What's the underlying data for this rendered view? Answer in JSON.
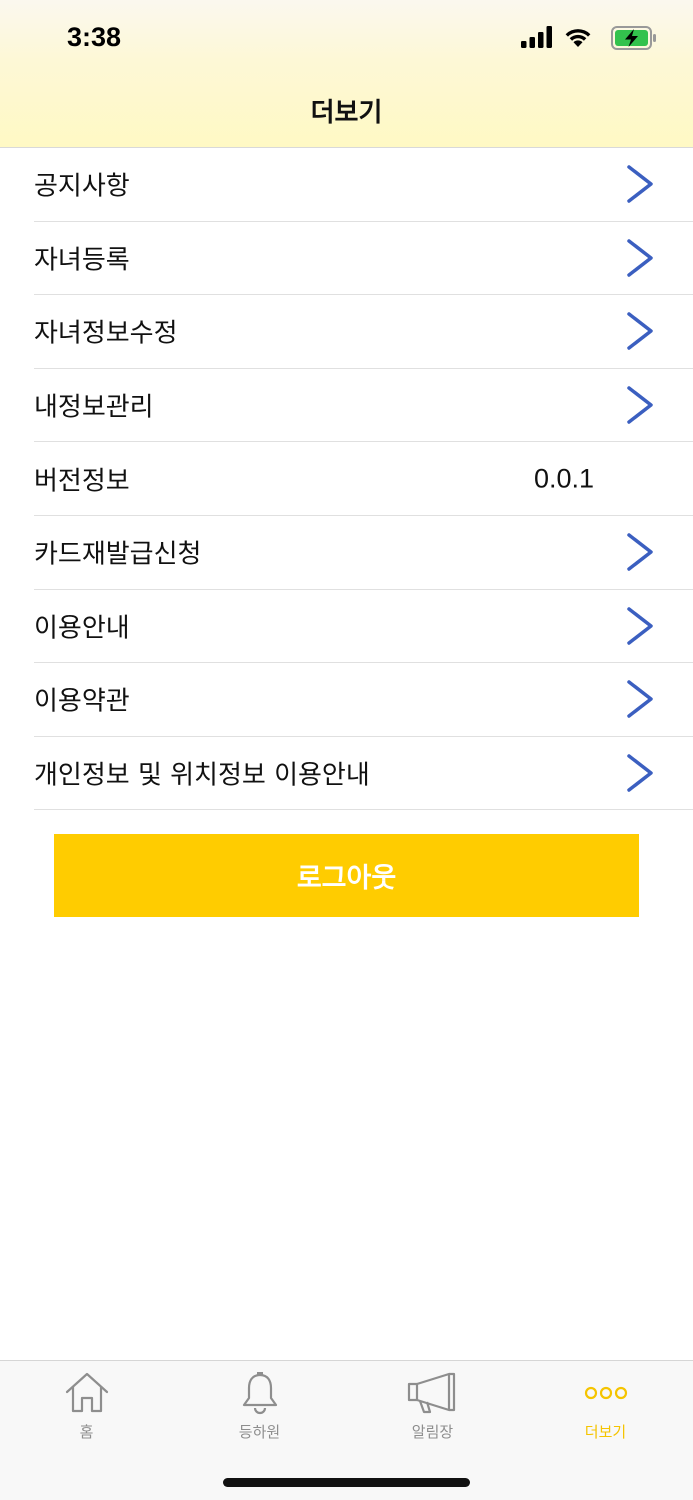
{
  "status_bar": {
    "time": "3:38"
  },
  "header": {
    "title": "더보기"
  },
  "menu": [
    {
      "label": "공지사항",
      "has_chevron": true
    },
    {
      "label": "자녀등록",
      "has_chevron": true
    },
    {
      "label": "자녀정보수정",
      "has_chevron": true
    },
    {
      "label": "내정보관리",
      "has_chevron": true
    },
    {
      "label": "버전정보",
      "value": "0.0.1",
      "has_chevron": false
    },
    {
      "label": "카드재발급신청",
      "has_chevron": true
    },
    {
      "label": "이용안내",
      "has_chevron": true
    },
    {
      "label": "이용약관",
      "has_chevron": true
    },
    {
      "label": "개인정보 및 위치정보 이용안내",
      "has_chevron": true
    }
  ],
  "logout_label": "로그아웃",
  "tabs": [
    {
      "label": "홈",
      "icon": "home-icon",
      "active": false
    },
    {
      "label": "등하원",
      "icon": "bell-icon",
      "active": false
    },
    {
      "label": "알림장",
      "icon": "megaphone-icon",
      "active": false
    },
    {
      "label": "더보기",
      "icon": "more-icon",
      "active": true
    }
  ],
  "colors": {
    "accent": "#ffcc00",
    "chevron": "#3b5fc0",
    "tab_active": "#f5c400",
    "tab_inactive": "#8e8e8e"
  }
}
